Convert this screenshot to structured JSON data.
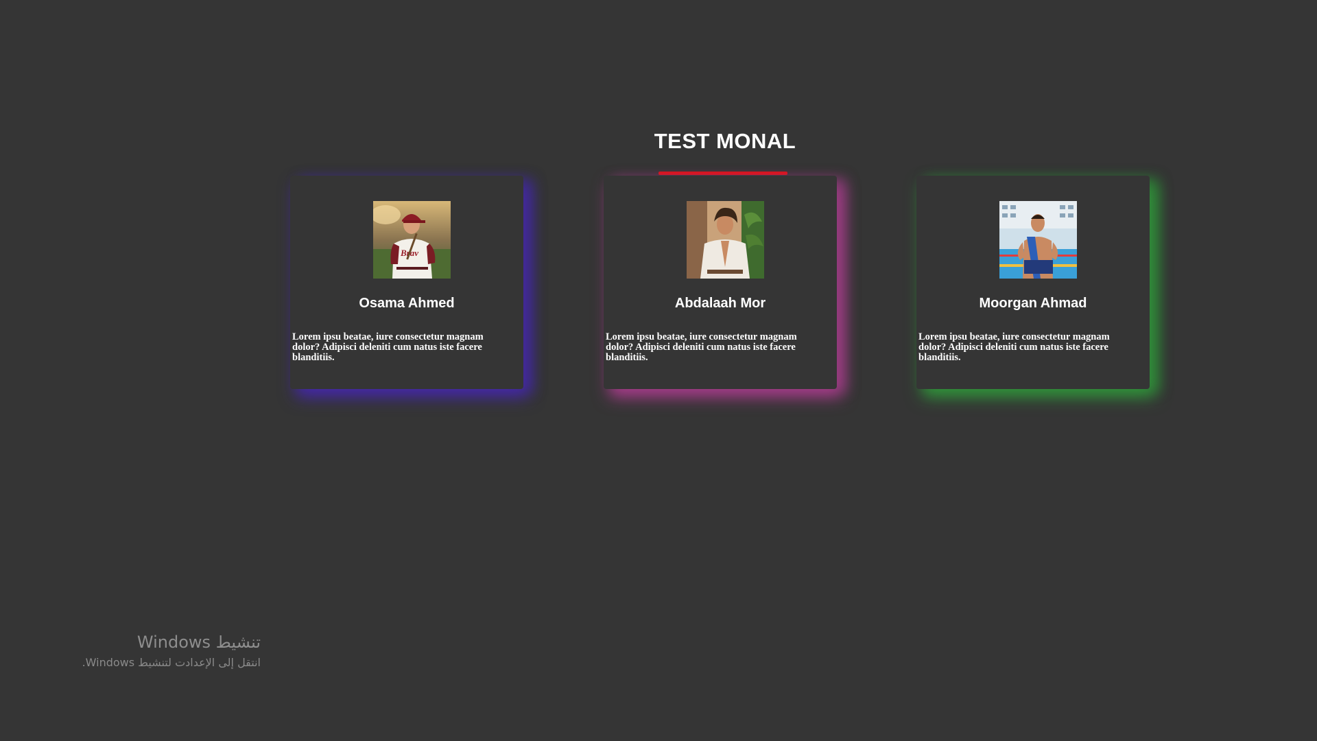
{
  "section": {
    "title": "TEST MONAL",
    "underline_color": "#e01010"
  },
  "cards": [
    {
      "name": "Osama Ahmed",
      "text": "Lorem ipsu beatae, iure consectetur magnam dolor? Adipisci deleniti cum natus iste facere blanditiis.",
      "glow_color": "#4628aa",
      "image": "baseball-player-photo"
    },
    {
      "name": "Abdalaah Mor",
      "text": "Lorem ipsu beatae, iure consectetur magnam dolor? Adipisci deleniti cum natus iste facere blanditiis.",
      "glow_color": "#aa3c8c",
      "image": "man-white-shirt-photo"
    },
    {
      "name": "Moorgan Ahmad",
      "text": "Lorem ipsu beatae, iure consectetur magnam dolor? Adipisci deleniti cum natus iste facere blanditiis.",
      "glow_color": "#32963c",
      "image": "wrestler-poolside-photo"
    }
  ],
  "watermark": {
    "title": "تنشيط Windows",
    "subtitle": "انتقل إلى الإعدادت لتنشيط Windows."
  }
}
